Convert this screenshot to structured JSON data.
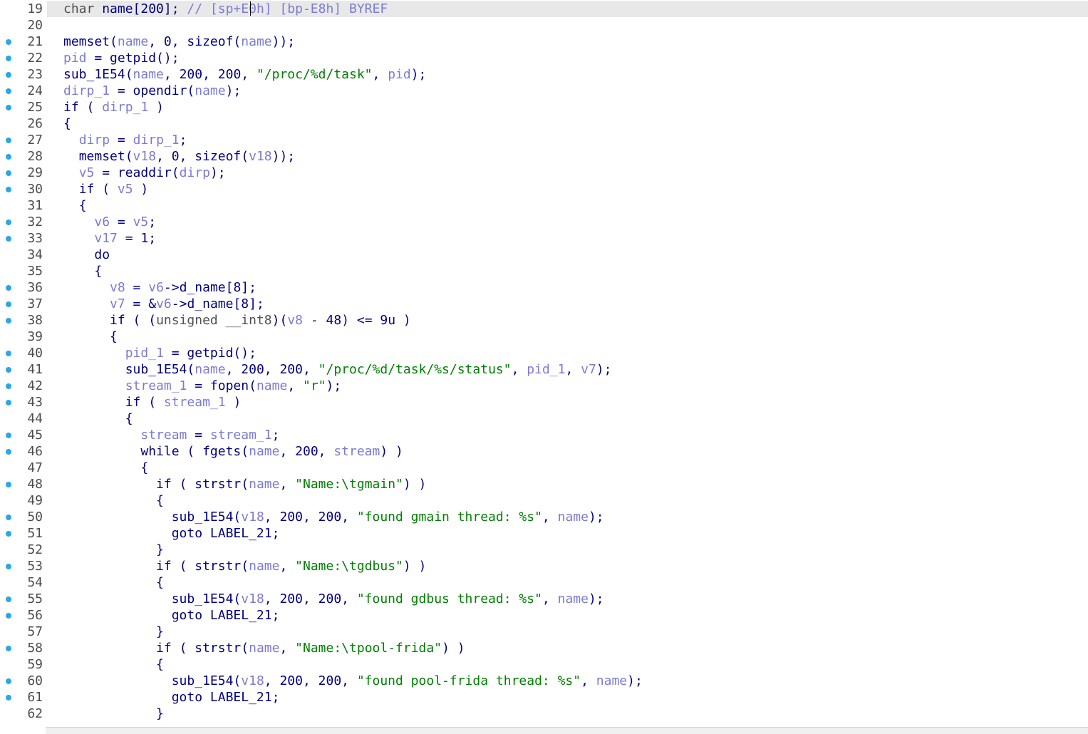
{
  "editor": {
    "current_line": 19,
    "colors": {
      "plain": "#000080",
      "variable": "#7b7bd6",
      "string": "#008000",
      "comment": "#7b7bd6",
      "breakpoint": "#2aa7e6",
      "current_line_bg": "#e8e8e8"
    },
    "lines": [
      {
        "n": "19",
        "bp": false,
        "indent": 0,
        "tokens": [
          [
            "type",
            "char"
          ],
          [
            "plain",
            " name[200]; "
          ],
          [
            "cmt",
            "// [sp+E0h] [bp-E8h] BYREF"
          ]
        ]
      },
      {
        "n": "20",
        "bp": false,
        "indent": 0,
        "tokens": []
      },
      {
        "n": "21",
        "bp": true,
        "indent": 0,
        "tokens": [
          [
            "plain",
            "memset("
          ],
          [
            "var",
            "name"
          ],
          [
            "plain",
            ", 0, sizeof("
          ],
          [
            "var",
            "name"
          ],
          [
            "plain",
            "));"
          ]
        ]
      },
      {
        "n": "22",
        "bp": true,
        "indent": 0,
        "tokens": [
          [
            "var",
            "pid"
          ],
          [
            "plain",
            " = getpid();"
          ]
        ]
      },
      {
        "n": "23",
        "bp": true,
        "indent": 0,
        "tokens": [
          [
            "plain",
            "sub_1E54("
          ],
          [
            "var",
            "name"
          ],
          [
            "plain",
            ", 200, 200, "
          ],
          [
            "str",
            "\"/proc/%d/task\""
          ],
          [
            "plain",
            ", "
          ],
          [
            "var",
            "pid"
          ],
          [
            "plain",
            ");"
          ]
        ]
      },
      {
        "n": "24",
        "bp": true,
        "indent": 0,
        "tokens": [
          [
            "var",
            "dirp_1"
          ],
          [
            "plain",
            " = opendir("
          ],
          [
            "var",
            "name"
          ],
          [
            "plain",
            ");"
          ]
        ]
      },
      {
        "n": "25",
        "bp": true,
        "indent": 0,
        "tokens": [
          [
            "kw",
            "if"
          ],
          [
            "plain",
            " ( "
          ],
          [
            "var",
            "dirp_1"
          ],
          [
            "plain",
            " )"
          ]
        ]
      },
      {
        "n": "26",
        "bp": false,
        "indent": 0,
        "tokens": [
          [
            "plain",
            "{"
          ]
        ]
      },
      {
        "n": "27",
        "bp": true,
        "indent": 1,
        "tokens": [
          [
            "var",
            "dirp"
          ],
          [
            "plain",
            " = "
          ],
          [
            "var",
            "dirp_1"
          ],
          [
            "plain",
            ";"
          ]
        ]
      },
      {
        "n": "28",
        "bp": true,
        "indent": 1,
        "tokens": [
          [
            "plain",
            "memset("
          ],
          [
            "var",
            "v18"
          ],
          [
            "plain",
            ", 0, sizeof("
          ],
          [
            "var",
            "v18"
          ],
          [
            "plain",
            "));"
          ]
        ]
      },
      {
        "n": "29",
        "bp": true,
        "indent": 1,
        "tokens": [
          [
            "var",
            "v5"
          ],
          [
            "plain",
            " = readdir("
          ],
          [
            "var",
            "dirp"
          ],
          [
            "plain",
            ");"
          ]
        ]
      },
      {
        "n": "30",
        "bp": true,
        "indent": 1,
        "tokens": [
          [
            "kw",
            "if"
          ],
          [
            "plain",
            " ( "
          ],
          [
            "var",
            "v5"
          ],
          [
            "plain",
            " )"
          ]
        ]
      },
      {
        "n": "31",
        "bp": false,
        "indent": 1,
        "tokens": [
          [
            "plain",
            "{"
          ]
        ]
      },
      {
        "n": "32",
        "bp": true,
        "indent": 2,
        "tokens": [
          [
            "var",
            "v6"
          ],
          [
            "plain",
            " = "
          ],
          [
            "var",
            "v5"
          ],
          [
            "plain",
            ";"
          ]
        ]
      },
      {
        "n": "33",
        "bp": true,
        "indent": 2,
        "tokens": [
          [
            "var",
            "v17"
          ],
          [
            "plain",
            " = 1;"
          ]
        ]
      },
      {
        "n": "34",
        "bp": false,
        "indent": 2,
        "tokens": [
          [
            "kw",
            "do"
          ]
        ]
      },
      {
        "n": "35",
        "bp": false,
        "indent": 2,
        "tokens": [
          [
            "plain",
            "{"
          ]
        ]
      },
      {
        "n": "36",
        "bp": true,
        "indent": 3,
        "tokens": [
          [
            "var",
            "v8"
          ],
          [
            "plain",
            " = "
          ],
          [
            "var",
            "v6"
          ],
          [
            "plain",
            "->d_name[8];"
          ]
        ]
      },
      {
        "n": "37",
        "bp": true,
        "indent": 3,
        "tokens": [
          [
            "var",
            "v7"
          ],
          [
            "plain",
            " = &"
          ],
          [
            "var",
            "v6"
          ],
          [
            "plain",
            "->d_name[8];"
          ]
        ]
      },
      {
        "n": "38",
        "bp": true,
        "indent": 3,
        "tokens": [
          [
            "kw",
            "if"
          ],
          [
            "plain",
            " ( ("
          ],
          [
            "type",
            "unsigned __int8"
          ],
          [
            "plain",
            ")("
          ],
          [
            "var",
            "v8"
          ],
          [
            "plain",
            " - 48) <= 9u )"
          ]
        ]
      },
      {
        "n": "39",
        "bp": false,
        "indent": 3,
        "tokens": [
          [
            "plain",
            "{"
          ]
        ]
      },
      {
        "n": "40",
        "bp": true,
        "indent": 4,
        "tokens": [
          [
            "var",
            "pid_1"
          ],
          [
            "plain",
            " = getpid();"
          ]
        ]
      },
      {
        "n": "41",
        "bp": true,
        "indent": 4,
        "tokens": [
          [
            "plain",
            "sub_1E54("
          ],
          [
            "var",
            "name"
          ],
          [
            "plain",
            ", 200, 200, "
          ],
          [
            "str",
            "\"/proc/%d/task/%s/status\""
          ],
          [
            "plain",
            ", "
          ],
          [
            "var",
            "pid_1"
          ],
          [
            "plain",
            ", "
          ],
          [
            "var",
            "v7"
          ],
          [
            "plain",
            ");"
          ]
        ]
      },
      {
        "n": "42",
        "bp": true,
        "indent": 4,
        "tokens": [
          [
            "var",
            "stream_1"
          ],
          [
            "plain",
            " = fopen("
          ],
          [
            "var",
            "name"
          ],
          [
            "plain",
            ", "
          ],
          [
            "str",
            "\"r\""
          ],
          [
            "plain",
            ");"
          ]
        ]
      },
      {
        "n": "43",
        "bp": true,
        "indent": 4,
        "tokens": [
          [
            "kw",
            "if"
          ],
          [
            "plain",
            " ( "
          ],
          [
            "var",
            "stream_1"
          ],
          [
            "plain",
            " )"
          ]
        ]
      },
      {
        "n": "44",
        "bp": false,
        "indent": 4,
        "tokens": [
          [
            "plain",
            "{"
          ]
        ]
      },
      {
        "n": "45",
        "bp": true,
        "indent": 5,
        "tokens": [
          [
            "var",
            "stream"
          ],
          [
            "plain",
            " = "
          ],
          [
            "var",
            "stream_1"
          ],
          [
            "plain",
            ";"
          ]
        ]
      },
      {
        "n": "46",
        "bp": true,
        "indent": 5,
        "tokens": [
          [
            "kw",
            "while"
          ],
          [
            "plain",
            " ( fgets("
          ],
          [
            "var",
            "name"
          ],
          [
            "plain",
            ", 200, "
          ],
          [
            "var",
            "stream"
          ],
          [
            "plain",
            ") )"
          ]
        ]
      },
      {
        "n": "47",
        "bp": false,
        "indent": 5,
        "tokens": [
          [
            "plain",
            "{"
          ]
        ]
      },
      {
        "n": "48",
        "bp": true,
        "indent": 6,
        "tokens": [
          [
            "kw",
            "if"
          ],
          [
            "plain",
            " ( strstr("
          ],
          [
            "var",
            "name"
          ],
          [
            "plain",
            ", "
          ],
          [
            "str",
            "\"Name:\\tgmain\""
          ],
          [
            "plain",
            ") )"
          ]
        ]
      },
      {
        "n": "49",
        "bp": false,
        "indent": 6,
        "tokens": [
          [
            "plain",
            "{"
          ]
        ]
      },
      {
        "n": "50",
        "bp": true,
        "indent": 7,
        "tokens": [
          [
            "plain",
            "sub_1E54("
          ],
          [
            "var",
            "v18"
          ],
          [
            "plain",
            ", 200, 200, "
          ],
          [
            "str",
            "\"found gmain thread: %s\""
          ],
          [
            "plain",
            ", "
          ],
          [
            "var",
            "name"
          ],
          [
            "plain",
            ");"
          ]
        ]
      },
      {
        "n": "51",
        "bp": true,
        "indent": 7,
        "tokens": [
          [
            "kw",
            "goto"
          ],
          [
            "plain",
            " LABEL_21;"
          ]
        ]
      },
      {
        "n": "52",
        "bp": false,
        "indent": 6,
        "tokens": [
          [
            "plain",
            "}"
          ]
        ]
      },
      {
        "n": "53",
        "bp": true,
        "indent": 6,
        "tokens": [
          [
            "kw",
            "if"
          ],
          [
            "plain",
            " ( strstr("
          ],
          [
            "var",
            "name"
          ],
          [
            "plain",
            ", "
          ],
          [
            "str",
            "\"Name:\\tgdbus\""
          ],
          [
            "plain",
            ") )"
          ]
        ]
      },
      {
        "n": "54",
        "bp": false,
        "indent": 6,
        "tokens": [
          [
            "plain",
            "{"
          ]
        ]
      },
      {
        "n": "55",
        "bp": true,
        "indent": 7,
        "tokens": [
          [
            "plain",
            "sub_1E54("
          ],
          [
            "var",
            "v18"
          ],
          [
            "plain",
            ", 200, 200, "
          ],
          [
            "str",
            "\"found gdbus thread: %s\""
          ],
          [
            "plain",
            ", "
          ],
          [
            "var",
            "name"
          ],
          [
            "plain",
            ");"
          ]
        ]
      },
      {
        "n": "56",
        "bp": true,
        "indent": 7,
        "tokens": [
          [
            "kw",
            "goto"
          ],
          [
            "plain",
            " LABEL_21;"
          ]
        ]
      },
      {
        "n": "57",
        "bp": false,
        "indent": 6,
        "tokens": [
          [
            "plain",
            "}"
          ]
        ]
      },
      {
        "n": "58",
        "bp": true,
        "indent": 6,
        "tokens": [
          [
            "kw",
            "if"
          ],
          [
            "plain",
            " ( strstr("
          ],
          [
            "var",
            "name"
          ],
          [
            "plain",
            ", "
          ],
          [
            "str",
            "\"Name:\\tpool-frida\""
          ],
          [
            "plain",
            ") )"
          ]
        ]
      },
      {
        "n": "59",
        "bp": false,
        "indent": 6,
        "tokens": [
          [
            "plain",
            "{"
          ]
        ]
      },
      {
        "n": "60",
        "bp": true,
        "indent": 7,
        "tokens": [
          [
            "plain",
            "sub_1E54("
          ],
          [
            "var",
            "v18"
          ],
          [
            "plain",
            ", 200, 200, "
          ],
          [
            "str",
            "\"found pool-frida thread: %s\""
          ],
          [
            "plain",
            ", "
          ],
          [
            "var",
            "name"
          ],
          [
            "plain",
            ");"
          ]
        ]
      },
      {
        "n": "61",
        "bp": true,
        "indent": 7,
        "tokens": [
          [
            "kw",
            "goto"
          ],
          [
            "plain",
            " LABEL_21;"
          ]
        ]
      },
      {
        "n": "62",
        "bp": false,
        "indent": 6,
        "tokens": [
          [
            "plain",
            "}"
          ]
        ]
      }
    ]
  }
}
